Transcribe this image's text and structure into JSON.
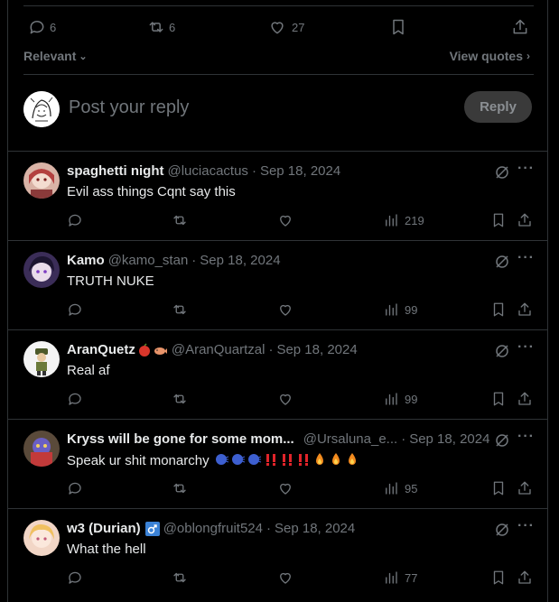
{
  "top_bar": {
    "replies": "6",
    "reposts": "6",
    "likes": "27"
  },
  "sort": {
    "label": "Relevant"
  },
  "quotes_link": {
    "label": "View quotes"
  },
  "compose": {
    "placeholder": "Post your reply",
    "button": "Reply"
  },
  "replies": [
    {
      "name": "spaghetti night",
      "handle": "@luciacactus",
      "date": "Sep 18, 2024",
      "text": "Evil ass things Cqnt say this",
      "views": "219",
      "avatar_color": "#c86a6a"
    },
    {
      "name": "Kamo",
      "handle": "@kamo_stan",
      "date": "Sep 18, 2024",
      "text": "TRUTH NUKE",
      "views": "99",
      "avatar_color": "#4a3b6b"
    },
    {
      "name": "AranQuetz",
      "handle": "@AranQuartzal",
      "date": "Sep 18, 2024",
      "text": "Real af",
      "views": "99",
      "avatar_color": "#f2f2f2"
    },
    {
      "name": "Kryss will be gone for some mom...",
      "handle": "@Ursaluna_e...",
      "date": "Sep 18, 2024",
      "text": "Speak ur shit monarchy",
      "views": "95",
      "avatar_color": "#3d5a8a"
    },
    {
      "name": "w3 (Durian)",
      "handle": "@oblongfruit524",
      "date": "Sep 18, 2024",
      "text": "What the hell",
      "views": "77",
      "avatar_color": "#e7b8a8"
    }
  ]
}
